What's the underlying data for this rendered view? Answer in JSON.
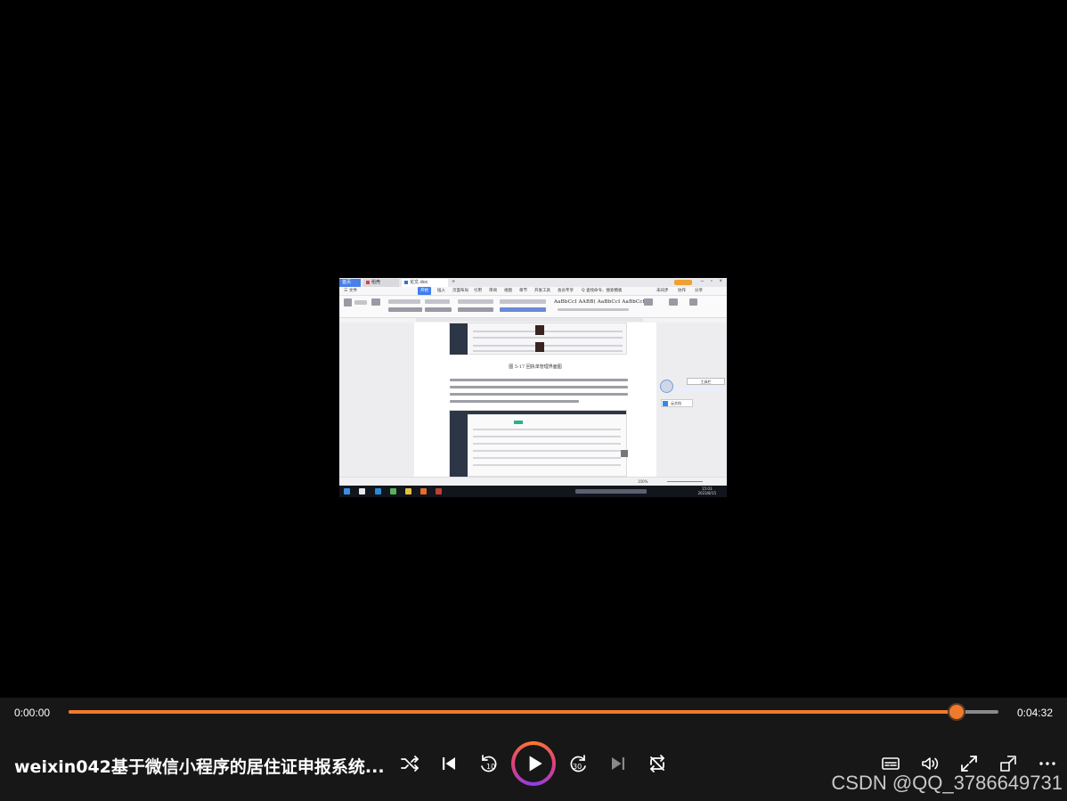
{
  "player": {
    "time_current": "0:00:00",
    "time_total": "0:04:32",
    "progress_fraction": 0.955,
    "title": "weixin042基于微信小程序的居住证申报系统...",
    "accent_color": "#f07a2c",
    "controls": [
      "shuffle-icon",
      "skip-previous-icon",
      "rewind-10-icon",
      "play-icon",
      "forward-30-icon",
      "skip-next-icon",
      "repeat-icon",
      "subtitles-icon",
      "volume-icon",
      "fullscreen-icon",
      "mini-player-icon",
      "more-options-icon"
    ],
    "rewind_label": "10",
    "forward_label": "30"
  },
  "watermark": "CSDN @QQ_3786649731",
  "recording": {
    "tabs": [
      "首页",
      "稻壳",
      "论文.doc"
    ],
    "menu": [
      "三 文件",
      "开始",
      "插入",
      "页面布局",
      "引用",
      "审阅",
      "视图",
      "章节",
      "开发工具",
      "会员专享",
      "Q 查找命令、搜索模板",
      "未同步",
      "协作",
      "分享"
    ],
    "styles_preview": "AaBbCcI AABB( AaBbCcI AaBbCcDc",
    "figure_caption": "图 5-17 回执单管理界面图",
    "side_pill": "工具栏",
    "share_label": "云文档",
    "zoom": "100%",
    "clock_time": "15:03",
    "clock_date": "2023/8/15"
  }
}
